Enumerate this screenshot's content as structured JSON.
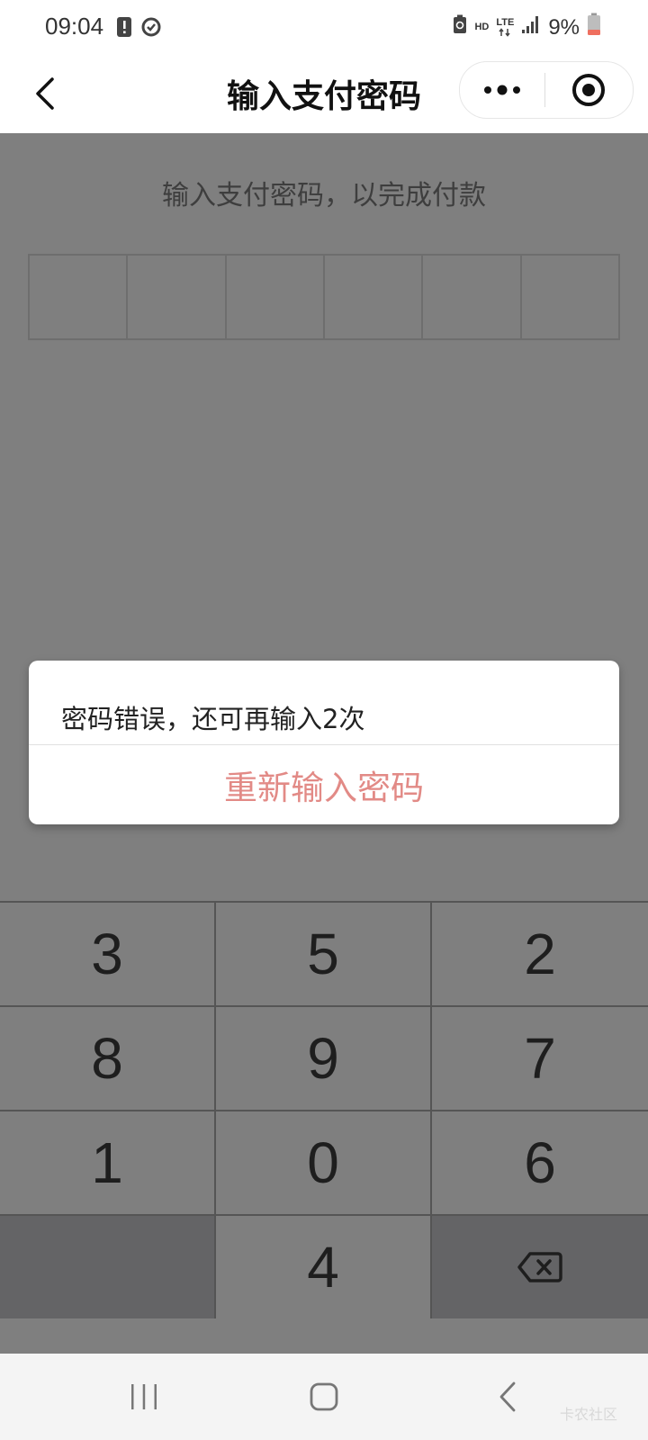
{
  "status_bar": {
    "time": "09:04",
    "network_hd": "HD",
    "network_lte": "LTE",
    "battery_percent": "9%",
    "icons": [
      "alert-icon",
      "sync-icon",
      "recycle-battery-icon",
      "signal-icon",
      "battery-icon"
    ]
  },
  "title_bar": {
    "title": "输入支付密码",
    "back_icon": "chevron-left-icon",
    "more_icon": "more-dots-icon",
    "close_icon": "target-close-icon"
  },
  "main": {
    "instruction": "输入支付密码，以完成付款",
    "pin_length": 6
  },
  "dialog": {
    "message": "密码错误，还可再输入2次",
    "button_label": "重新输入密码",
    "button_color": "#e28a86"
  },
  "keypad": {
    "keys": [
      "3",
      "5",
      "2",
      "8",
      "9",
      "7",
      "1",
      "0",
      "6",
      "",
      "4",
      "backspace"
    ]
  },
  "nav_bar": {
    "icons": [
      "recent-apps-icon",
      "home-icon",
      "back-icon"
    ]
  },
  "watermark": "卡农社区"
}
